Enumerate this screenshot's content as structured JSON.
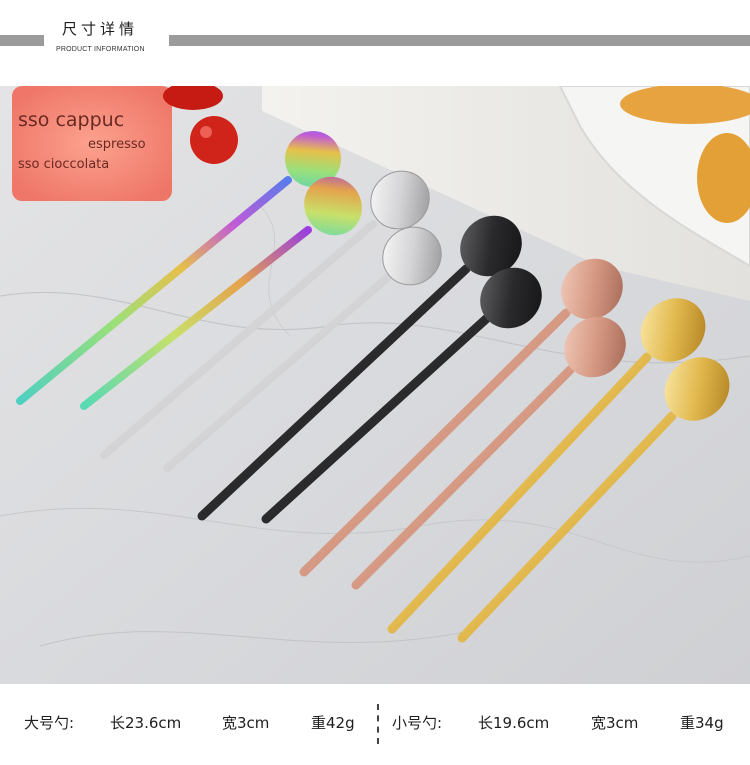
{
  "header": {
    "title_cn": "尺寸详情",
    "title_en": "PRODUCT INFORMATION"
  },
  "photo": {
    "glass_text_lines": [
      "sso cappuc",
      "espresso",
      "sso cioccolata"
    ],
    "spoon_colors": [
      "rainbow",
      "rainbow-violet",
      "silver",
      "silver",
      "black",
      "black",
      "rose-gold",
      "rose-gold",
      "gold",
      "gold"
    ]
  },
  "specs": {
    "large": {
      "label": "大号勺:",
      "length": "长23.6cm",
      "width": "宽3cm",
      "weight": "重42g"
    },
    "small": {
      "label": "小号勺:",
      "length": "长19.6cm",
      "width": "宽3cm",
      "weight": "重34g"
    }
  }
}
